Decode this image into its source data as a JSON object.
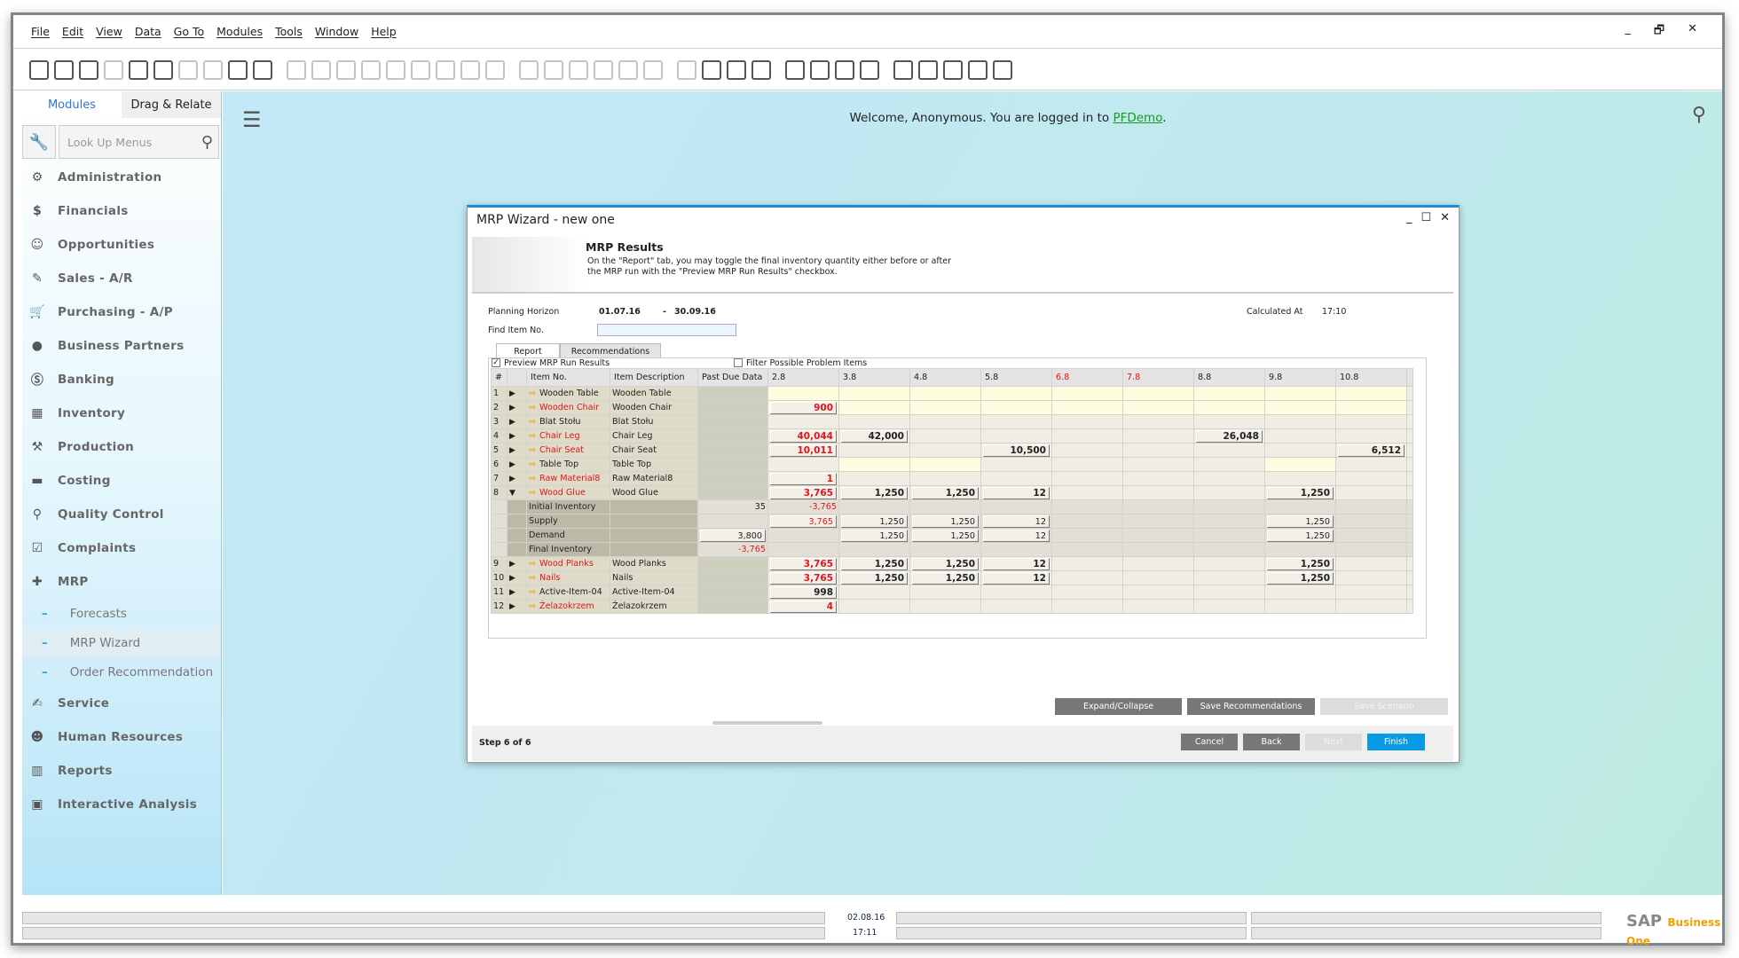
{
  "menu": [
    "File",
    "Edit",
    "View",
    "Data",
    "Go To",
    "Modules",
    "Tools",
    "Window",
    "Help"
  ],
  "window_controls": {
    "minimize": "_",
    "restore": "🗗",
    "close": "✕"
  },
  "toolbar_icons": [
    "preview-icon",
    "print-icon",
    "email-icon",
    "sms-icon",
    "fax-icon",
    "excel-icon",
    "word-icon",
    "pdf-icon",
    "move-icon",
    "form-settings-icon",
    "find-icon",
    "add-icon",
    "first-record-icon",
    "previous-record-icon",
    "next-record-icon",
    "last-record-icon",
    "refresh-icon",
    "filter-icon",
    "sort-icon",
    "base-document-icon",
    "target-document-icon",
    "payment-means-icon",
    "gross-profit-icon",
    "volume-weight-icon",
    "layout-icon",
    "journal-icon",
    "edit-icon",
    "settings-icon",
    "query-icon",
    "alerts-icon",
    "messages-icon",
    "calendar-icon",
    "org-icon",
    "dashboard-icon",
    "widgets-icon",
    "chart-icon",
    "export-icon",
    "help-icon"
  ],
  "sidebar": {
    "tabs": [
      "Modules",
      "Drag & Relate"
    ],
    "lookup_placeholder": "Look Up Menus",
    "items": [
      {
        "label": "Administration",
        "icon": "⚙"
      },
      {
        "label": "Financials",
        "icon": "$"
      },
      {
        "label": "Opportunities",
        "icon": "☺"
      },
      {
        "label": "Sales - A/R",
        "icon": "✎"
      },
      {
        "label": "Purchasing - A/P",
        "icon": "🛒"
      },
      {
        "label": "Business Partners",
        "icon": "●"
      },
      {
        "label": "Banking",
        "icon": "Ⓢ"
      },
      {
        "label": "Inventory",
        "icon": "▦"
      },
      {
        "label": "Production",
        "icon": "⚒"
      },
      {
        "label": "Costing",
        "icon": "▬"
      },
      {
        "label": "Quality Control",
        "icon": "⚲"
      },
      {
        "label": "Complaints",
        "icon": "☑"
      },
      {
        "label": "MRP",
        "icon": "✚"
      }
    ],
    "mrp_sub": [
      "Forecasts",
      "MRP Wizard",
      "Order Recommendation"
    ],
    "items_after": [
      {
        "label": "Service",
        "icon": "✍"
      },
      {
        "label": "Human Resources",
        "icon": "☻"
      },
      {
        "label": "Reports",
        "icon": "▥"
      },
      {
        "label": "Interactive Analysis",
        "icon": "▣"
      }
    ]
  },
  "main": {
    "welcome_prefix": "Welcome, Anonymous. You are logged in to ",
    "company": "PFDemo",
    "welcome_suffix": "."
  },
  "dialog": {
    "title": "MRP Wizard - new one",
    "controls": {
      "minimize": "_",
      "maximize": "☐",
      "close": "✕"
    },
    "banner_title": "MRP Results",
    "banner_desc": "On the \"Report\" tab, you may toggle the final inventory quantity either before or after the MRP run with the \"Preview MRP Run Results\" checkbox.",
    "planning_horizon_label": "Planning Horizon",
    "from": "01.07.16",
    "dash": "-",
    "to": "30.09.16",
    "calculated_at_label": "Calculated At",
    "calculated_at": "17:10",
    "find_item_label": "Find Item No.",
    "find_item_value": "",
    "tabs": [
      "Report",
      "Recommendations"
    ],
    "active_tab": "Report",
    "preview_label": "Preview MRP Run Results",
    "preview_checked": true,
    "filter_label": "Filter Possible Problem Items",
    "filter_checked": false,
    "grid": {
      "headers": [
        "#",
        "",
        "Item No.",
        "Item Description",
        "Past Due Data",
        "2.8",
        "3.8",
        "4.8",
        "5.8",
        "6.8",
        "7.8",
        "8.8",
        "9.8",
        "10.8"
      ],
      "red_headers": [
        "6.8",
        "7.8"
      ],
      "rows": [
        {
          "n": "1",
          "item": "Wooden Table",
          "desc": "Wooden Table",
          "item_red": false,
          "expanded": false,
          "cells": [
            "",
            "",
            "",
            "",
            "",
            "",
            "",
            "",
            ""
          ],
          "red": [],
          "highlight": [
            0,
            1,
            2,
            3,
            4,
            5,
            6,
            7,
            8
          ]
        },
        {
          "n": "2",
          "item": "Wooden Chair",
          "desc": "Wooden Chair",
          "item_red": true,
          "expanded": false,
          "cells": [
            "900",
            "",
            "",
            "",
            "",
            "",
            "",
            "",
            ""
          ],
          "red": [
            0
          ],
          "highlight": [
            0,
            1,
            2,
            3,
            4,
            5,
            6,
            7,
            8
          ]
        },
        {
          "n": "3",
          "item": "Blat Stołu",
          "desc": "Blat Stołu",
          "item_red": false,
          "expanded": false,
          "cells": [
            "",
            "",
            "",
            "",
            "",
            "",
            "",
            "",
            ""
          ],
          "red": [],
          "highlight": []
        },
        {
          "n": "4",
          "item": "Chair Leg",
          "desc": "Chair Leg",
          "item_red": true,
          "expanded": false,
          "cells": [
            "40,044",
            "42,000",
            "",
            "",
            "",
            "",
            "26,048",
            "",
            ""
          ],
          "red": [
            0
          ],
          "highlight": []
        },
        {
          "n": "5",
          "item": "Chair Seat",
          "desc": "Chair Seat",
          "item_red": true,
          "expanded": false,
          "cells": [
            "10,011",
            "",
            "",
            "10,500",
            "",
            "",
            "",
            "",
            "6,512"
          ],
          "red": [
            0
          ],
          "highlight": []
        },
        {
          "n": "6",
          "item": "Table Top",
          "desc": "Table Top",
          "item_red": false,
          "expanded": false,
          "cells": [
            "",
            "",
            "",
            "",
            "",
            "",
            "",
            "",
            ""
          ],
          "red": [],
          "highlight": [
            1,
            2,
            7
          ]
        },
        {
          "n": "7",
          "item": "Raw Material8",
          "desc": "Raw Material8",
          "item_red": true,
          "expanded": false,
          "cells": [
            "1",
            "",
            "",
            "",
            "",
            "",
            "",
            "",
            ""
          ],
          "red": [
            0
          ],
          "highlight": []
        },
        {
          "n": "8",
          "item": "Wood Glue",
          "desc": "Wood Glue",
          "item_red": true,
          "expanded": true,
          "cells": [
            "3,765",
            "1,250",
            "1,250",
            "12",
            "",
            "",
            "",
            "1,250",
            ""
          ],
          "red": [
            0
          ],
          "highlight": [],
          "sub": [
            {
              "label": "Initial Inventory",
              "past_due": "35",
              "past_due_red": false,
              "past_due_boxed": false,
              "cells": [
                "-3,765",
                "",
                "",
                "",
                "",
                "",
                "",
                "",
                ""
              ],
              "red": [
                0
              ],
              "plain": [
                0
              ]
            },
            {
              "label": "Supply",
              "past_due": "",
              "past_due_red": false,
              "past_due_boxed": false,
              "cells": [
                "3,765",
                "1,250",
                "1,250",
                "12",
                "",
                "",
                "",
                "1,250",
                ""
              ],
              "red": [
                0
              ],
              "plain": []
            },
            {
              "label": "Demand",
              "past_due": "3,800",
              "past_due_red": false,
              "past_due_boxed": true,
              "cells": [
                "",
                "1,250",
                "1,250",
                "12",
                "",
                "",
                "",
                "1,250",
                ""
              ],
              "red": [],
              "plain": []
            },
            {
              "label": "Final Inventory",
              "past_due": "-3,765",
              "past_due_red": true,
              "past_due_boxed": false,
              "cells": [
                "",
                "",
                "",
                "",
                "",
                "",
                "",
                "",
                ""
              ],
              "red": [],
              "plain": []
            }
          ]
        },
        {
          "n": "9",
          "item": "Wood Planks",
          "desc": "Wood Planks",
          "item_red": true,
          "expanded": false,
          "cells": [
            "3,765",
            "1,250",
            "1,250",
            "12",
            "",
            "",
            "",
            "1,250",
            ""
          ],
          "red": [
            0
          ],
          "highlight": []
        },
        {
          "n": "10",
          "item": "Nails",
          "desc": "Nails",
          "item_red": true,
          "expanded": false,
          "cells": [
            "3,765",
            "1,250",
            "1,250",
            "12",
            "",
            "",
            "",
            "1,250",
            ""
          ],
          "red": [
            0
          ],
          "highlight": []
        },
        {
          "n": "11",
          "item": "Active-Item-04",
          "desc": "Active-Item-04",
          "item_red": false,
          "expanded": false,
          "cells": [
            "998",
            "",
            "",
            "",
            "",
            "",
            "",
            "",
            ""
          ],
          "red": [],
          "highlight": []
        },
        {
          "n": "12",
          "item": "Żelazokrzem",
          "desc": "Żelazokrzem",
          "item_red": true,
          "expanded": false,
          "cells": [
            "4",
            "",
            "",
            "",
            "",
            "",
            "",
            "",
            ""
          ],
          "red": [
            0
          ],
          "highlight": []
        }
      ]
    },
    "buttons": {
      "expand": "Expand/Collapse",
      "save_rec": "Save Recommendations",
      "save_scenario": "Save Scenario",
      "cancel": "Cancel",
      "back": "Back",
      "next": "Next",
      "finish": "Finish"
    },
    "step": "Step 6 of 6"
  },
  "status": {
    "date": "02.08.16",
    "time": "17:11",
    "logo": "SAP",
    "logo_sub": "Business One"
  },
  "colors": {
    "accent": "#0a9ae4",
    "error": "#e0141e",
    "link": "#1a9a1a"
  }
}
